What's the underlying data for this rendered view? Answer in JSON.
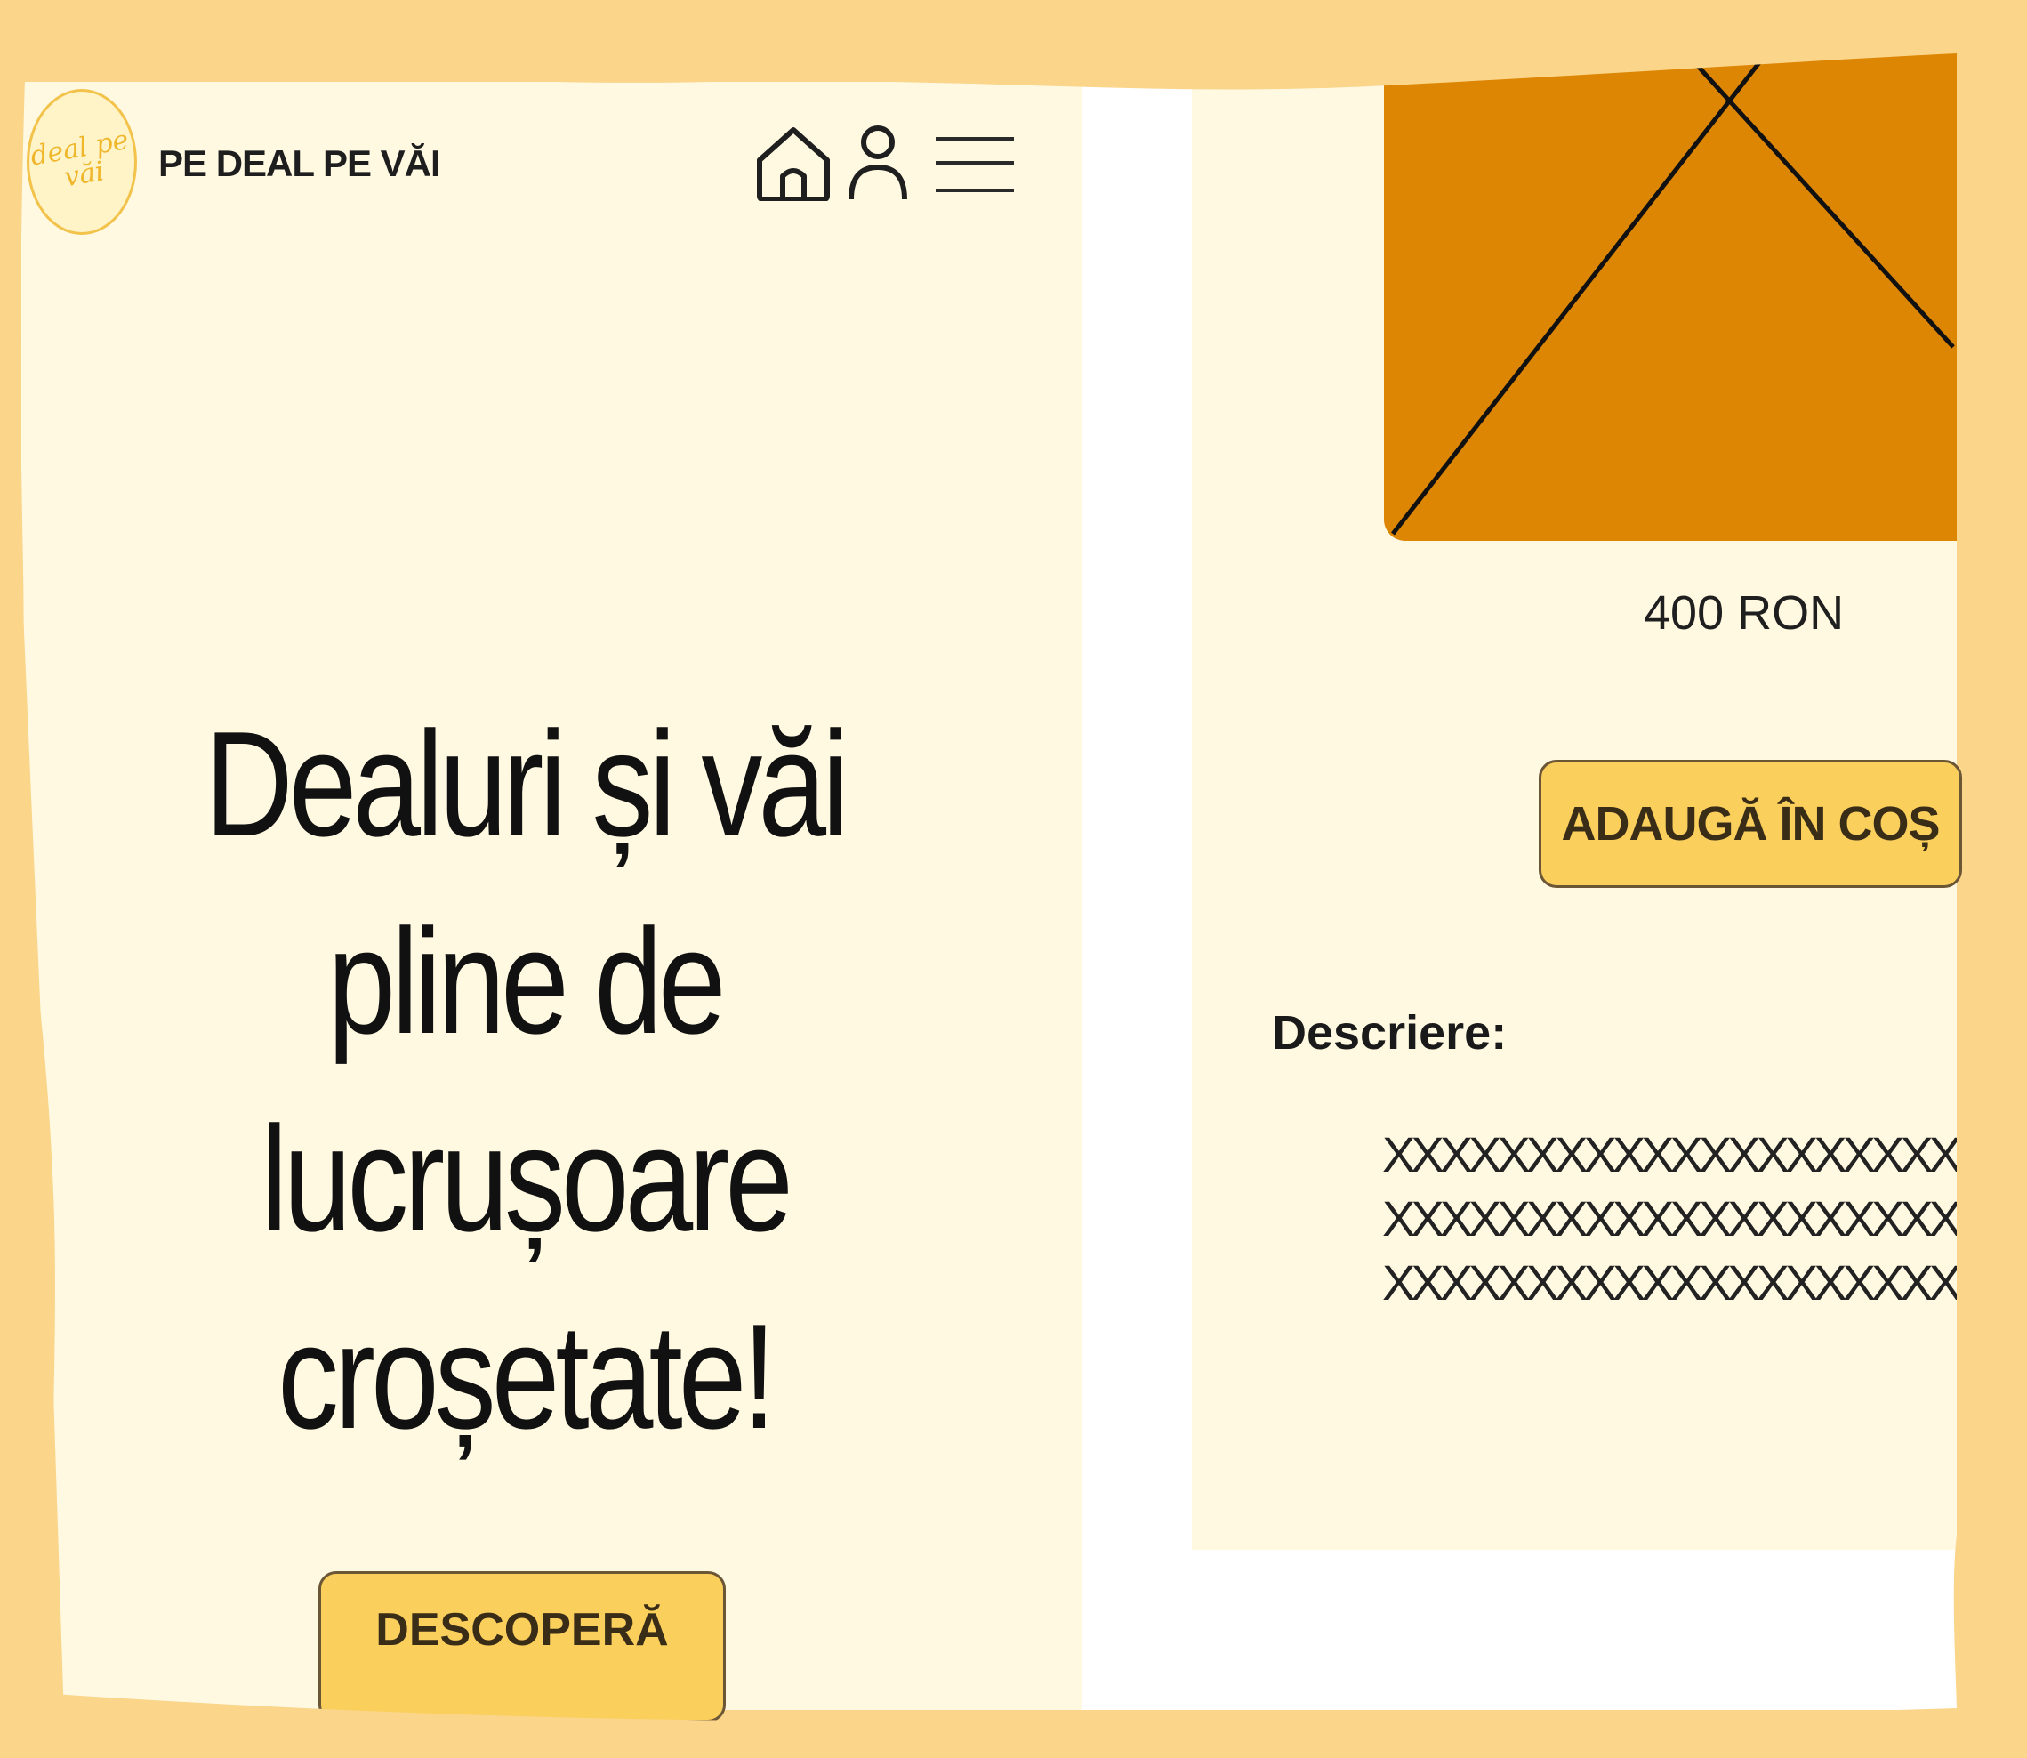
{
  "header": {
    "brand": "PE DEAL PE VĂI",
    "logo_text": "deal pe văi",
    "icons": [
      "home-icon",
      "user-icon",
      "menu-icon"
    ]
  },
  "hero": {
    "title_lines": [
      "Dealuri și văi",
      "pline de",
      "lucrușoare",
      "croșetate!"
    ],
    "button_label": "DESCOPERĂ"
  },
  "product": {
    "image": "placeholder-image-icon",
    "price": "400 RON",
    "add_button_label": "ADAUGĂ ÎN COȘ",
    "description_label": "Descriere:",
    "description_lines": [
      "XXXXXXXXXXXXXXXXXXXX",
      "XXXXXXXXXXXXXXXXXXXX",
      "XXXXXXXXXXXXXXXXXXXX"
    ]
  },
  "colors": {
    "background_frame": "#fad58a",
    "panel": "#fff9e1",
    "button": "#fbcf5c",
    "image_placeholder": "#dd8604",
    "text": "#111111"
  }
}
